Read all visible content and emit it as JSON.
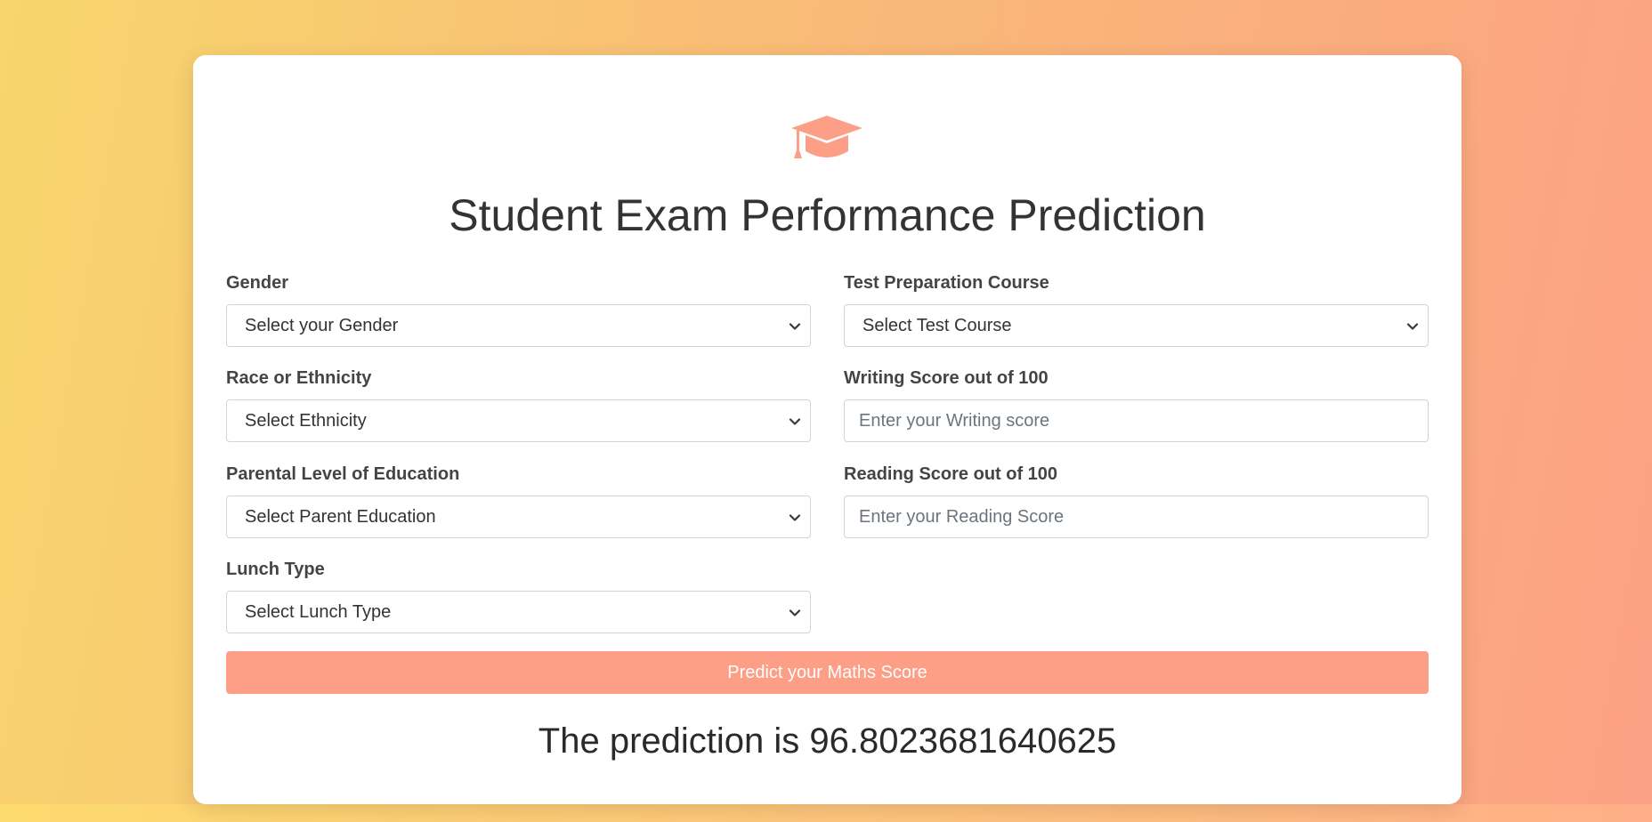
{
  "header": {
    "icon": "graduation-cap-icon",
    "title": "Student Exam Performance Prediction"
  },
  "form": {
    "gender": {
      "label": "Gender",
      "selected": "Select your Gender"
    },
    "ethnicity": {
      "label": "Race or Ethnicity",
      "selected": "Select Ethnicity"
    },
    "parental_education": {
      "label": "Parental Level of Education",
      "selected": "Select Parent Education"
    },
    "lunch": {
      "label": "Lunch Type",
      "selected": "Select Lunch Type"
    },
    "test_prep": {
      "label": "Test Preparation Course",
      "selected": "Select Test Course"
    },
    "writing": {
      "label": "Writing Score out of 100",
      "placeholder": "Enter your Writing score"
    },
    "reading": {
      "label": "Reading Score out of 100",
      "placeholder": "Enter your Reading Score"
    },
    "submit_label": "Predict your Maths Score"
  },
  "result": {
    "text": "The prediction is 96.8023681640625"
  },
  "colors": {
    "accent": "#fc9f86",
    "background_start": "#f8d66c",
    "background_end": "#fca184"
  }
}
